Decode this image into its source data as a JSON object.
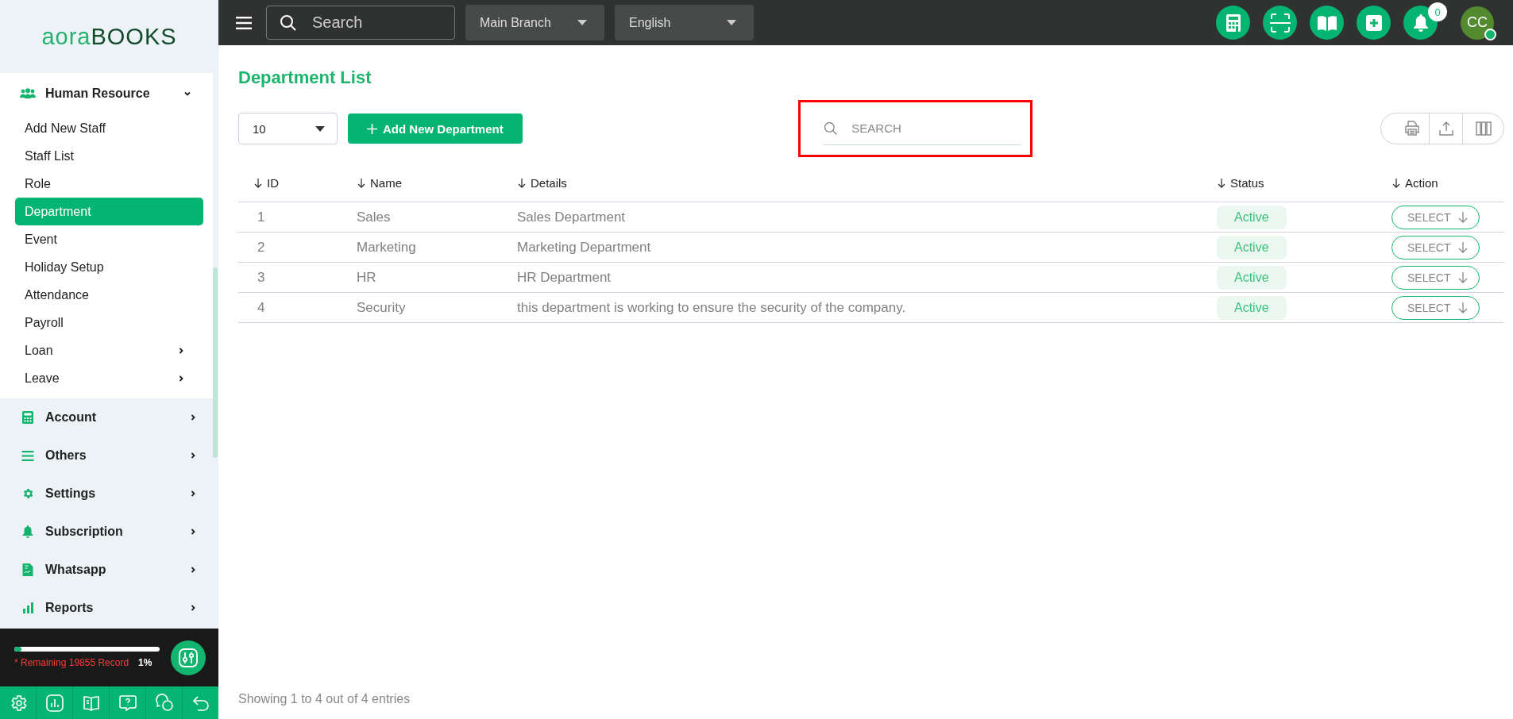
{
  "sidebar": {
    "logo": {
      "light": "aora",
      "dark": "BOOKS"
    },
    "menu": [
      {
        "label": "Human Resource",
        "expanded": true,
        "children": [
          {
            "label": "Add New Staff",
            "selected": false,
            "has_submenu": false
          },
          {
            "label": "Staff List",
            "selected": false,
            "has_submenu": false
          },
          {
            "label": "Role",
            "selected": false,
            "has_submenu": false
          },
          {
            "label": "Department",
            "selected": true,
            "has_submenu": false
          },
          {
            "label": "Event",
            "selected": false,
            "has_submenu": false
          },
          {
            "label": "Holiday Setup",
            "selected": false,
            "has_submenu": false
          },
          {
            "label": "Attendance",
            "selected": false,
            "has_submenu": false
          },
          {
            "label": "Payroll",
            "selected": false,
            "has_submenu": false
          },
          {
            "label": "Loan",
            "selected": false,
            "has_submenu": true
          },
          {
            "label": "Leave",
            "selected": false,
            "has_submenu": true
          }
        ]
      },
      {
        "label": "Account",
        "expanded": false
      },
      {
        "label": "Others",
        "expanded": false
      },
      {
        "label": "Settings",
        "expanded": false
      },
      {
        "label": "Subscription",
        "expanded": false
      },
      {
        "label": "Whatsapp",
        "expanded": false
      },
      {
        "label": "Reports",
        "expanded": false
      }
    ],
    "usage": {
      "level": 0.01,
      "reading": "1%",
      "note": "* Remaining 19855 Record"
    }
  },
  "topbar": {
    "search": {
      "placeholder": "Search"
    },
    "branch": "Main Branch",
    "language": "English",
    "notifications": "0",
    "avatar": {
      "initials": "CC",
      "online": true
    }
  },
  "page": {
    "title": "Department List",
    "page_size": "10",
    "add_button": "Add New Department",
    "search": {
      "placeholder": "SEARCH",
      "highlighted": true
    },
    "table": {
      "columns": [
        "ID",
        "Name",
        "Details",
        "Status",
        "Action"
      ],
      "rows": [
        {
          "id": "1",
          "name": "Sales",
          "details": "Sales Department",
          "status": "Active",
          "action": "SELECT"
        },
        {
          "id": "2",
          "name": "Marketing",
          "details": "Marketing Department",
          "status": "Active",
          "action": "SELECT"
        },
        {
          "id": "3",
          "name": "HR",
          "details": "HR Department",
          "status": "Active",
          "action": "SELECT"
        },
        {
          "id": "4",
          "name": "Security",
          "details": "this department is working to ensure the security of the company.",
          "status": "Active",
          "action": "SELECT"
        }
      ]
    },
    "footer": "Showing 1 to 4 out of 4 entries"
  }
}
